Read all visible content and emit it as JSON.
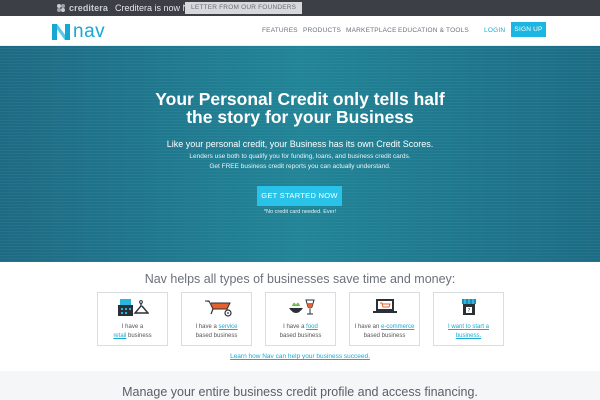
{
  "topbar": {
    "brand": "creditera",
    "message": "Creditera is now Nav",
    "letter_button": "LETTER FROM OUR FOUNDERS"
  },
  "nav": {
    "logo_text": "nav",
    "menu": [
      "FEATURES",
      "PRODUCTS",
      "MARKETPLACE",
      "EDUCATION & TOOLS"
    ],
    "login": "LOGIN",
    "signup": "SIGN UP"
  },
  "hero": {
    "title_line1": "Your Personal Credit only tells half",
    "title_line2": "the story for your Business",
    "subtitle": "Like your personal credit, your Business has its own Credit Scores.",
    "line2": "Lenders use both to qualify you for funding, loans, and business credit cards.",
    "line3": "Get FREE business credit reports you can actually understand.",
    "cta": "GET STARTED NOW",
    "note": "*No credit card needed. Ever!"
  },
  "types": {
    "heading": "Nav helps all types of businesses save time and money:",
    "cards": [
      {
        "pre": "I have a",
        "link": "retail",
        "post": "business",
        "icon": "cash-register-icon"
      },
      {
        "pre": "I have a",
        "link": "service",
        "post": "based business",
        "icon": "wheelbarrow-icon"
      },
      {
        "pre": "I have a",
        "link": "food",
        "post": "based business",
        "icon": "food-drink-icon"
      },
      {
        "pre": "I have an",
        "link": "e-commerce",
        "post": "based business",
        "icon": "laptop-cart-icon"
      },
      {
        "pre": "",
        "link": "I want to start a",
        "post": "business.",
        "icon": "storefront-icon"
      }
    ],
    "learn_link": "Learn how Nav can help your business succeed."
  },
  "bottom": {
    "heading": "Manage your entire business credit profile and access financing."
  },
  "colors": {
    "accent": "#1bb6e1",
    "hero_teal": "#1f7a8c",
    "topbar": "#3d3f47"
  }
}
